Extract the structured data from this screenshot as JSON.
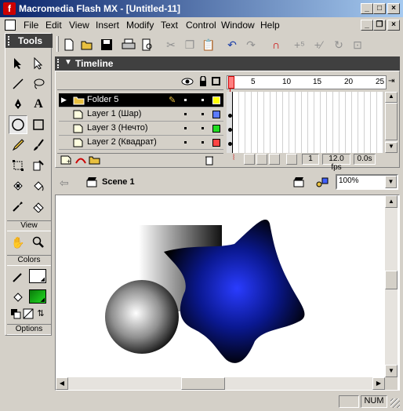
{
  "window": {
    "title": "Macromedia Flash MX - [Untitled-11]"
  },
  "menu": [
    "File",
    "Edit",
    "View",
    "Insert",
    "Modify",
    "Text",
    "Control",
    "Window",
    "Help"
  ],
  "tools": {
    "title": "Tools",
    "sections": {
      "view": "View",
      "colors": "Colors",
      "options": "Options"
    },
    "selected_tool": "oval-tool"
  },
  "timeline": {
    "title": "Timeline",
    "frame_ticks": [
      "5",
      "10",
      "15",
      "20",
      "25"
    ],
    "layers": [
      {
        "name": "Folder 5",
        "type": "folder",
        "selected": true,
        "color": "#ffff00"
      },
      {
        "name": "Layer 1 (Шар)",
        "type": "layer",
        "selected": false,
        "color": "#5b7bff"
      },
      {
        "name": "Layer 3 (Нечто)",
        "type": "layer",
        "selected": false,
        "color": "#22dd22"
      },
      {
        "name": "Layer 2 (Квадрат)",
        "type": "layer",
        "selected": false,
        "color": "#ff4444"
      }
    ],
    "current_frame": "1",
    "fps": "12.0 fps",
    "elapsed": "0.0s"
  },
  "scene": {
    "name": "Scene 1",
    "zoom": "100%"
  },
  "status": {
    "num": "NUM"
  }
}
